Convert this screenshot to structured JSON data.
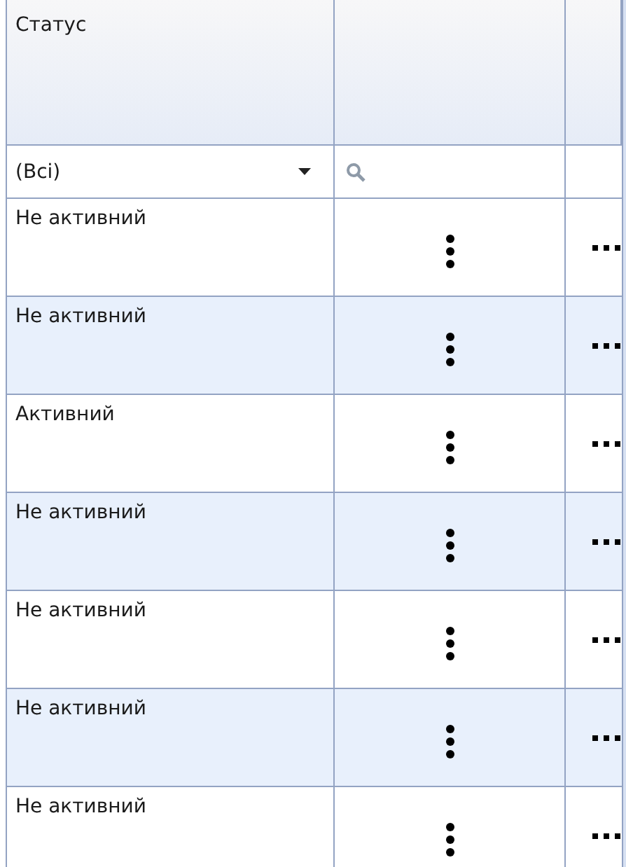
{
  "table": {
    "columns": [
      {
        "kind": "text",
        "label": "Статус"
      },
      {
        "kind": "actions"
      },
      {
        "kind": "more"
      }
    ],
    "filter": {
      "value": "(Всі)"
    },
    "rows": [
      {
        "status": "Не активний"
      },
      {
        "status": "Не активний"
      },
      {
        "status": "Активний"
      },
      {
        "status": "Не активний"
      },
      {
        "status": "Не активний"
      },
      {
        "status": "Не активний"
      },
      {
        "status": "Не активний"
      }
    ]
  }
}
